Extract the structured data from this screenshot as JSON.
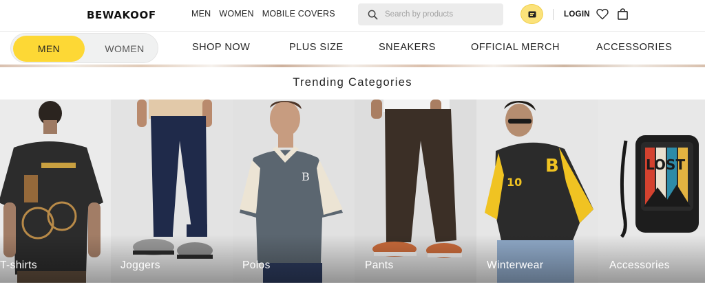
{
  "header": {
    "logo_text": "BEWAKOOF",
    "nav": [
      "MEN",
      "WOMEN",
      "MOBILE COVERS"
    ],
    "search_placeholder": "Search by products",
    "login_label": "LOGIN",
    "accent_color": "#fdd835"
  },
  "gender_switch": {
    "men": "MEN",
    "women": "WOMEN",
    "selected": "MEN"
  },
  "category_nav": [
    "SHOP NOW",
    "PLUS SIZE",
    "SNEAKERS",
    "OFFICIAL MERCH",
    "ACCESSORIES"
  ],
  "trending": {
    "title": "Trending Categories",
    "items": [
      {
        "label": "T-shirts"
      },
      {
        "label": "Joggers"
      },
      {
        "label": "Polos"
      },
      {
        "label": "Pants"
      },
      {
        "label": "Winterwear"
      },
      {
        "label": "Accessories"
      }
    ]
  },
  "icons": [
    "search-icon",
    "promo-icon",
    "heart-icon",
    "bag-icon",
    "owl-logo-icon"
  ]
}
